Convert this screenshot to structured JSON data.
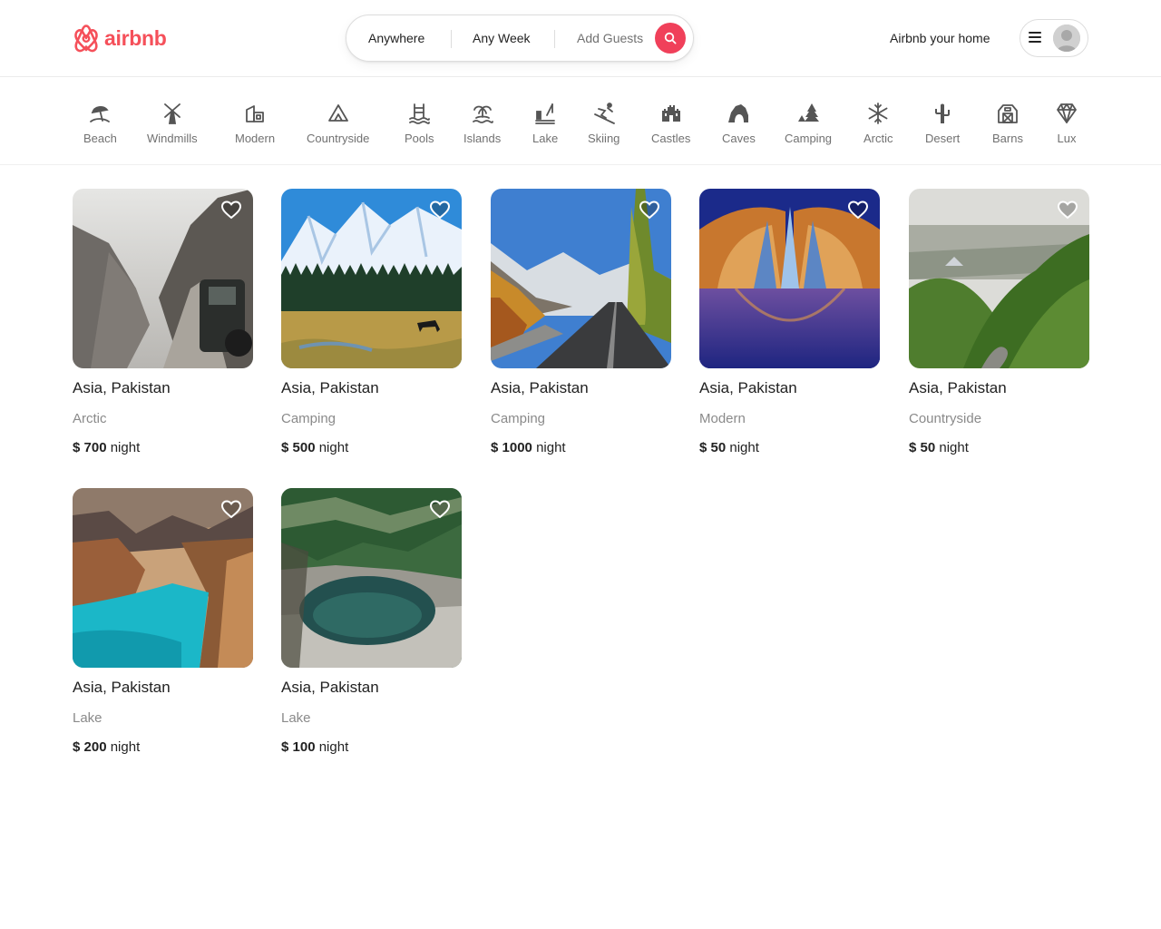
{
  "header": {
    "logo_text": "airbnb",
    "search": {
      "anywhere": "Anywhere",
      "any_week": "Any Week",
      "add_guests": "Add Guests"
    },
    "host_link": "Airbnb your home"
  },
  "categories": [
    {
      "label": "Beach",
      "icon": "beach-icon"
    },
    {
      "label": "Windmills",
      "icon": "windmill-icon"
    },
    {
      "label": "Modern",
      "icon": "modern-house-icon"
    },
    {
      "label": "Countryside",
      "icon": "countryside-icon"
    },
    {
      "label": "Pools",
      "icon": "pool-icon"
    },
    {
      "label": "Islands",
      "icon": "island-icon"
    },
    {
      "label": "Lake",
      "icon": "lake-icon"
    },
    {
      "label": "Skiing",
      "icon": "skiing-icon"
    },
    {
      "label": "Castles",
      "icon": "castle-icon"
    },
    {
      "label": "Caves",
      "icon": "cave-icon"
    },
    {
      "label": "Camping",
      "icon": "camping-icon"
    },
    {
      "label": "Arctic",
      "icon": "snowflake-icon"
    },
    {
      "label": "Desert",
      "icon": "cactus-icon"
    },
    {
      "label": "Barns",
      "icon": "barn-icon"
    },
    {
      "label": "Lux",
      "icon": "diamond-icon"
    }
  ],
  "listings": [
    {
      "title": "Asia, Pakistan",
      "category": "Arctic",
      "currency": "$",
      "price": "700",
      "unit": "night"
    },
    {
      "title": "Asia, Pakistan",
      "category": "Camping",
      "currency": "$",
      "price": "500",
      "unit": "night"
    },
    {
      "title": "Asia, Pakistan",
      "category": "Camping",
      "currency": "$",
      "price": "1000",
      "unit": "night"
    },
    {
      "title": "Asia, Pakistan",
      "category": "Modern",
      "currency": "$",
      "price": "50",
      "unit": "night"
    },
    {
      "title": "Asia, Pakistan",
      "category": "Countryside",
      "currency": "$",
      "price": "50",
      "unit": "night"
    },
    {
      "title": "Asia, Pakistan",
      "category": "Lake",
      "currency": "$",
      "price": "200",
      "unit": "night"
    },
    {
      "title": "Asia, Pakistan",
      "category": "Lake",
      "currency": "$",
      "price": "100",
      "unit": "night"
    }
  ],
  "colors": {
    "brand": "#f5505a",
    "search_button": "#f0405a",
    "text_primary": "#222222",
    "text_secondary": "#717171"
  }
}
